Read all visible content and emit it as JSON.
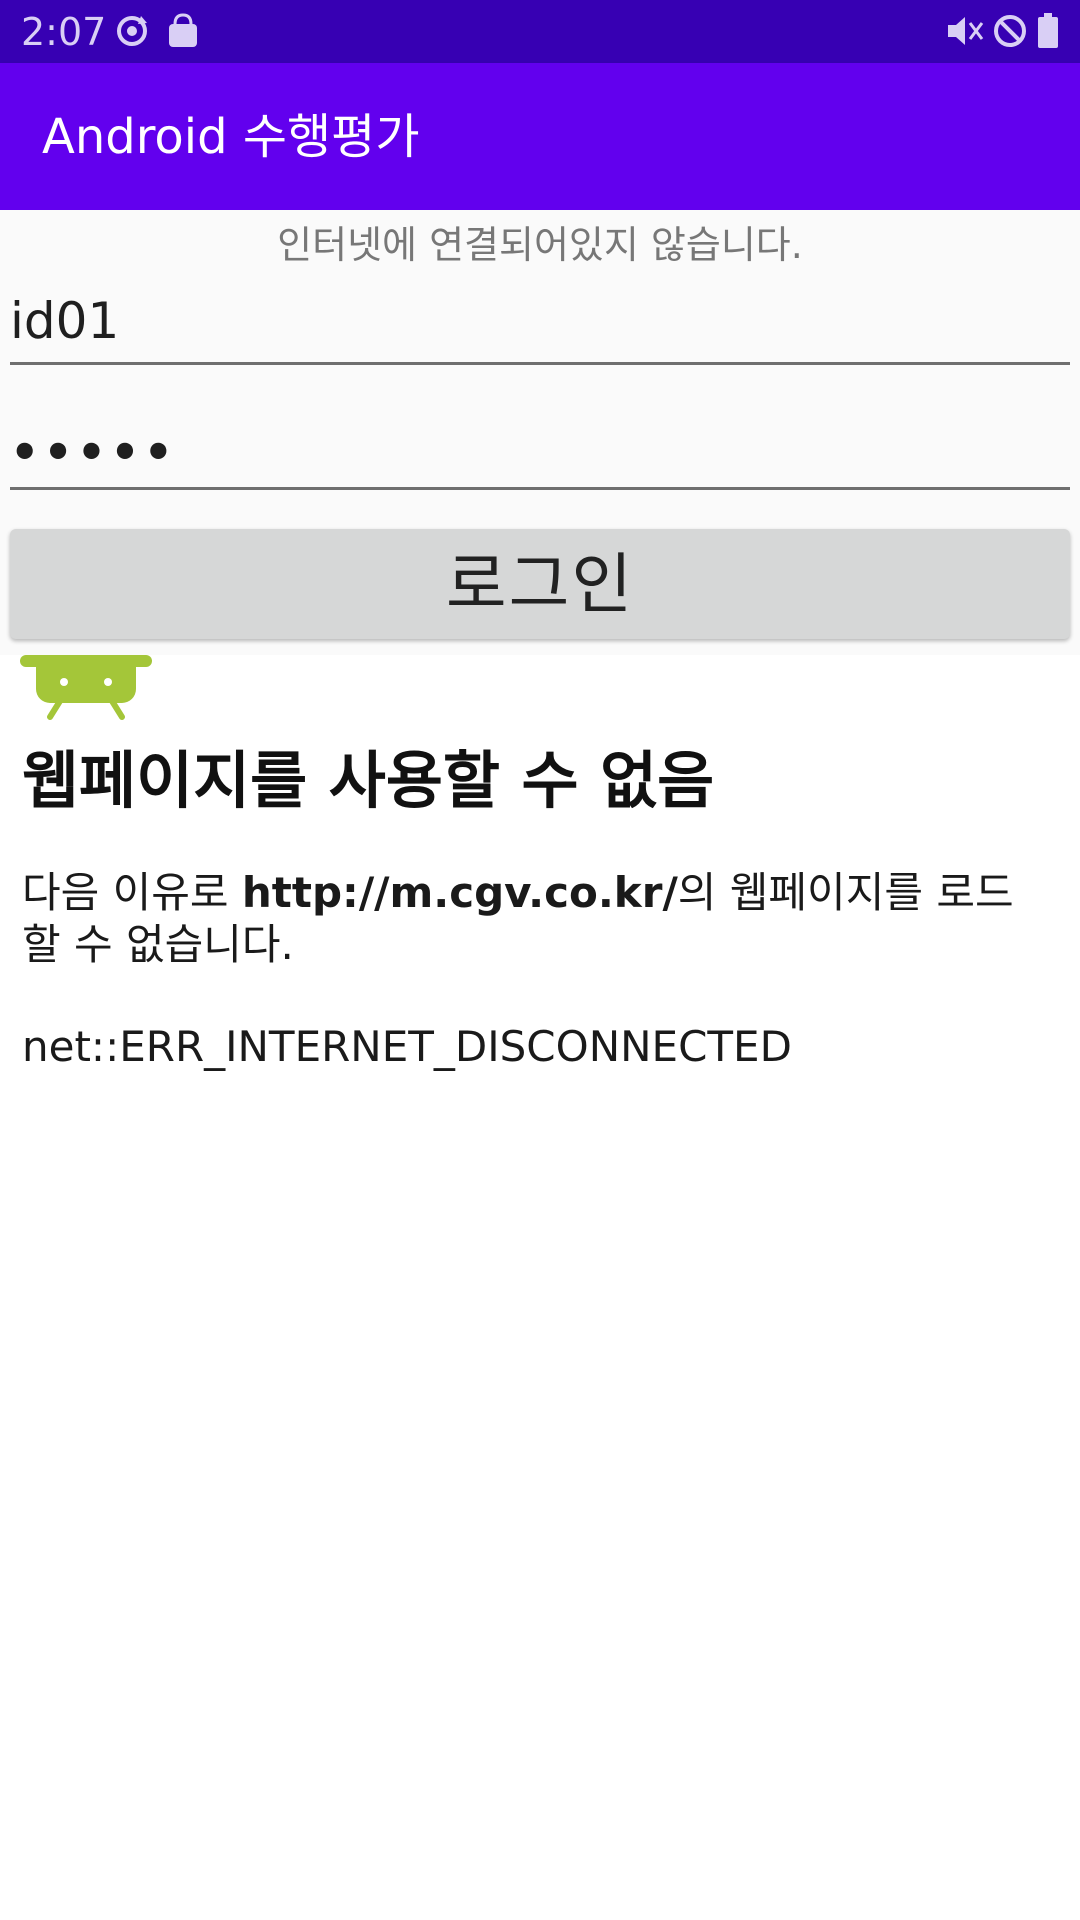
{
  "status_bar": {
    "time": "2:07",
    "icons": [
      "sync-icon",
      "shopping-bag-icon",
      "vibrate-mute-icon",
      "do-not-disturb-icon",
      "battery-icon"
    ]
  },
  "app_bar": {
    "title": "Android 수행평가"
  },
  "login": {
    "network_message": "인터넷에 연결되어있지 않습니다.",
    "id_value": "id01",
    "password_value": "•••••",
    "login_button": "로그인"
  },
  "webview": {
    "icon": "android-robot-icon",
    "title": "웹페이지를 사용할 수 없음",
    "desc_prefix": "다음 이유로 ",
    "desc_url": "http://m.cgv.co.kr/",
    "desc_suffix": "의 웹페이지를 로드할 수 없습니다.",
    "error_code": "net::ERR_INTERNET_DISCONNECTED"
  },
  "colors": {
    "status_bar": "#3700b3",
    "app_bar": "#6200ee",
    "button": "#d6d7d7",
    "android_green": "#a4c639"
  }
}
